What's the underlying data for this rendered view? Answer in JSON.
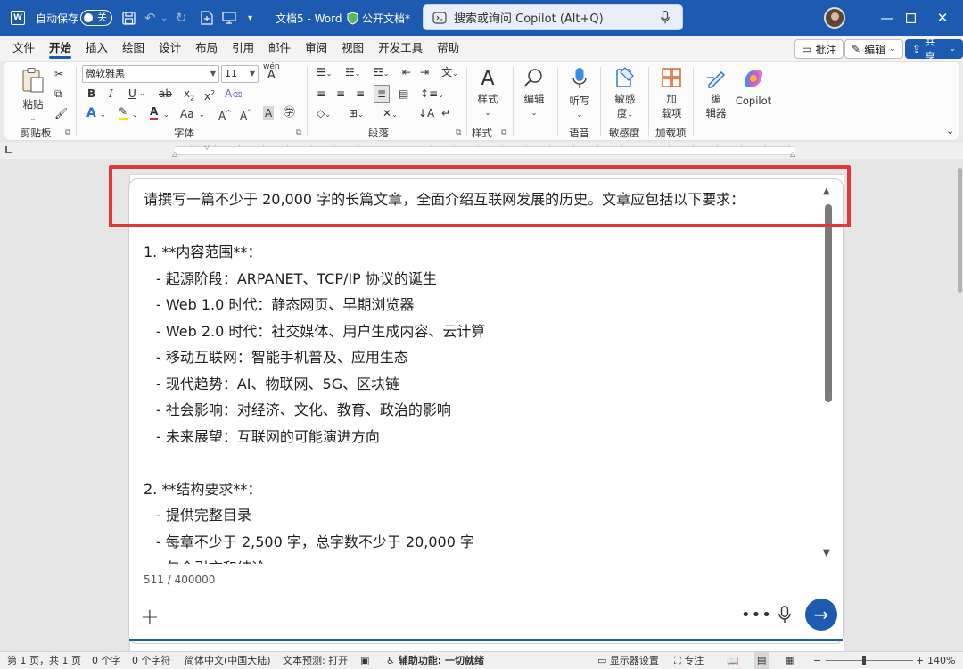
{
  "titlebar": {
    "autosave_label": "自动保存",
    "autosave_state": "关",
    "doc_title": "文档5 - Word",
    "sensitivity": "公开文档*",
    "search_placeholder": "搜索或询问 Copilot (Alt+Q)"
  },
  "menu": {
    "tabs": [
      "文件",
      "开始",
      "插入",
      "绘图",
      "设计",
      "布局",
      "引用",
      "邮件",
      "审阅",
      "视图",
      "开发工具",
      "帮助"
    ],
    "active_tab": "开始",
    "comment": "批注",
    "edit": "编辑",
    "share": "共享"
  },
  "ribbon": {
    "paste": "粘贴",
    "font_name": "微软雅黑",
    "font_size": "11",
    "styles": "样式",
    "edit": "编辑",
    "dictate": "听写",
    "sensitivity_1": "敏感",
    "sensitivity_2": "度",
    "addins_1": "加",
    "addins_2": "载项",
    "editor_1": "编",
    "editor_2": "辑器",
    "copilot": "Copilot",
    "groups": {
      "clipboard": "剪贴板",
      "font": "字体",
      "paragraph": "段落",
      "styles": "样式",
      "voice": "语音",
      "sensitivity": "敏感度",
      "addins": "加载项"
    }
  },
  "prompt": {
    "lines": [
      "请撰写一篇不少于 20,000 字的长篇文章，全面介绍互联网发展的历史。文章应包括以下要求：",
      "",
      "1. **内容范围**：",
      "- 起源阶段：ARPANET、TCP/IP 协议的诞生",
      "- Web 1.0 时代：静态网页、早期浏览器",
      "- Web 2.0 时代：社交媒体、用户生成内容、云计算",
      "- 移动互联网：智能手机普及、应用生态",
      "- 现代趋势：AI、物联网、5G、区块链",
      "- 社会影响：对经济、文化、教育、政治的影响",
      "- 未来展望：互联网的可能演进方向",
      "",
      "2. **结构要求**：",
      "- 提供完整目录",
      "- 每章不少于 2,500 字，总字数不少于 20,000 字",
      "- 包含引言和结论"
    ],
    "counter": "511 / 400000"
  },
  "statusbar": {
    "page": "第 1 页，共 1 页",
    "words": "0 个字",
    "chars": "0 个字符",
    "language": "简体中文(中国大陆)",
    "prediction": "文本预测: 打开",
    "accessibility": "辅助功能: 一切就绪",
    "display_settings": "显示器设置",
    "focus": "专注",
    "zoom": "140%"
  },
  "colors": {
    "brand": "#1c5bb0",
    "highlight": "#e4373d"
  }
}
